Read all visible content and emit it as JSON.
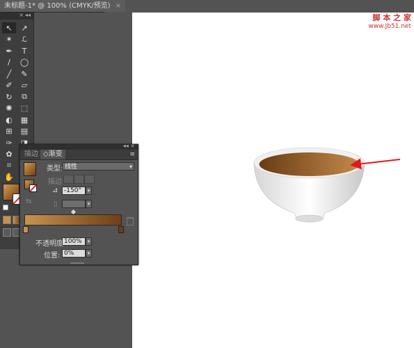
{
  "document": {
    "tab_title": "未标题-1* @ 100% (CMYK/预览)",
    "close_glyph": "×"
  },
  "watermark": {
    "logo_text": "脚 本 之 家",
    "url_text": "www.Jb51.net"
  },
  "tools": {
    "collapse_glyph": "◂◂",
    "close_glyph": "×",
    "items": [
      {
        "icon": "selection-tool-icon",
        "glyph": "↖"
      },
      {
        "icon": "direct-selection-tool-icon",
        "glyph": "↗"
      },
      {
        "icon": "magic-wand-tool-icon",
        "glyph": "✶"
      },
      {
        "icon": "lasso-tool-icon",
        "glyph": "ℒ"
      },
      {
        "icon": "pen-tool-icon",
        "glyph": "✒"
      },
      {
        "icon": "type-tool-icon",
        "glyph": "T"
      },
      {
        "icon": "line-segment-tool-icon",
        "glyph": "/"
      },
      {
        "icon": "ellipse-tool-icon",
        "glyph": "◯"
      },
      {
        "icon": "paintbrush-tool-icon",
        "glyph": "╱"
      },
      {
        "icon": "pencil-tool-icon",
        "glyph": "✎"
      },
      {
        "icon": "blob-brush-tool-icon",
        "glyph": "✐"
      },
      {
        "icon": "eraser-tool-icon",
        "glyph": "▱"
      },
      {
        "icon": "rotate-tool-icon",
        "glyph": "↻"
      },
      {
        "icon": "scale-tool-icon",
        "glyph": "⧉"
      },
      {
        "icon": "warp-tool-icon",
        "glyph": "✺"
      },
      {
        "icon": "free-transform-tool-icon",
        "glyph": "⬚"
      },
      {
        "icon": "shape-builder-tool-icon",
        "glyph": "◐"
      },
      {
        "icon": "perspective-grid-tool-icon",
        "glyph": "▦"
      },
      {
        "icon": "mesh-tool-icon",
        "glyph": "⊞"
      },
      {
        "icon": "gradient-tool-icon",
        "glyph": "▤"
      },
      {
        "icon": "eyedropper-tool-icon",
        "glyph": "✑"
      },
      {
        "icon": "blend-tool-icon",
        "glyph": "◨"
      },
      {
        "icon": "symbol-sprayer-tool-icon",
        "glyph": "✿"
      },
      {
        "icon": "column-graph-tool-icon",
        "glyph": "▥"
      },
      {
        "icon": "artboard-tool-icon",
        "glyph": "⌗"
      },
      {
        "icon": "slice-tool-icon",
        "glyph": "⊘"
      },
      {
        "icon": "hand-tool-icon",
        "glyph": "✋"
      },
      {
        "icon": "zoom-tool-icon",
        "glyph": "⚲"
      }
    ]
  },
  "gradient_panel": {
    "tabs": {
      "stroke_tab": "描边",
      "gradient_tab": "◇渐变"
    },
    "panel_controls": "◂◂ ×",
    "menu_glyph": "≡",
    "type_label": "类型:",
    "type_value": "线性",
    "stroke_label": "描边",
    "angle_value": "-150°",
    "aspect_value": "",
    "opacity_label": "不透明度:",
    "opacity_value": "100%",
    "location_label": "位置:",
    "location_value": "0%",
    "colors": {
      "start": "#c8924e",
      "end": "#6e3f16"
    }
  },
  "colors": {
    "arrow": "#e01a1a",
    "bowl_liquid_light": "#c28a4a",
    "bowl_liquid_dark": "#6a3b14"
  }
}
